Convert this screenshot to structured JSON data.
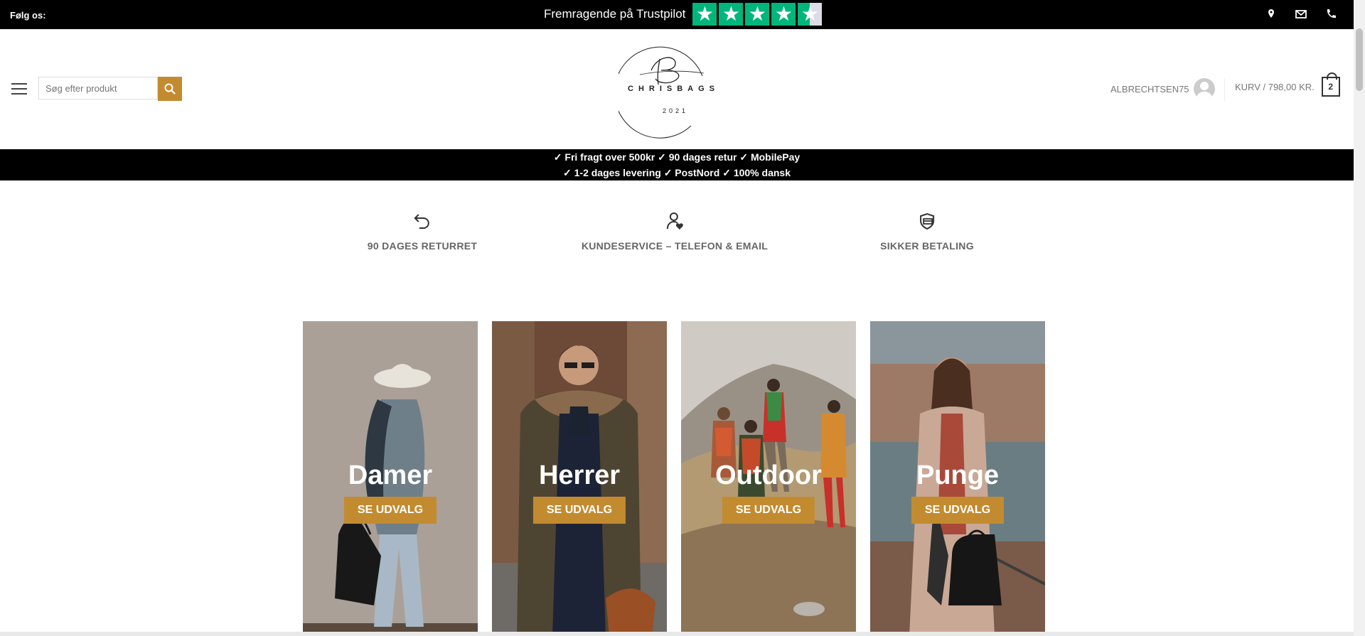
{
  "topbar": {
    "follow_label": "Følg os:",
    "trustpilot_text": "Fremragende på Trustpilot",
    "trustpilot_rating": 4.5,
    "trustpilot_color": "#00b67a"
  },
  "header": {
    "search_placeholder": "Søg efter produkt",
    "logo": {
      "brand": "CHRISBAGS",
      "year": "2021"
    },
    "account_name": "ALBRECHTSEN75",
    "cart_label": "KURV / 798,00 KR.",
    "cart_count": "2"
  },
  "usp": {
    "line1": "✓ Fri fragt over 500kr ✓ 90 dages retur ✓ MobilePay",
    "line2": "✓ 1-2 dages levering ✓ PostNord ✓ 100% dansk"
  },
  "features": [
    {
      "icon": "return-arrow-icon",
      "label": "90 DAGES RETURRET"
    },
    {
      "icon": "customer-service-icon",
      "label": "KUNDESERVICE – TELEFON & EMAIL"
    },
    {
      "icon": "secure-payment-icon",
      "label": "SIKKER BETALING"
    }
  ],
  "categories": [
    {
      "title": "Damer",
      "button": "SE UDVALG"
    },
    {
      "title": "Herrer",
      "button": "SE UDVALG"
    },
    {
      "title": "Outdoor",
      "button": "SE UDVALG"
    },
    {
      "title": "Punge",
      "button": "SE UDVALG"
    }
  ],
  "colors": {
    "accent": "#c38b2f",
    "bar": "#000000"
  }
}
